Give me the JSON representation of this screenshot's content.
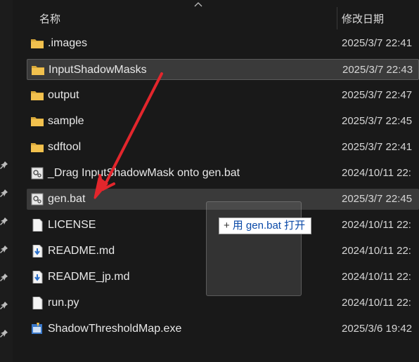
{
  "header": {
    "name_col": "名称",
    "date_col": "修改日期"
  },
  "files": [
    {
      "name": ".images",
      "date": "2025/3/7 22:41",
      "icon": "folder-icon"
    },
    {
      "name": "InputShadowMasks",
      "date": "2025/3/7 22:43",
      "icon": "folder-icon"
    },
    {
      "name": "output",
      "date": "2025/3/7 22:47",
      "icon": "folder-icon"
    },
    {
      "name": "sample",
      "date": "2025/3/7 22:45",
      "icon": "folder-icon"
    },
    {
      "name": "sdftool",
      "date": "2025/3/7 22:41",
      "icon": "folder-icon"
    },
    {
      "name": "_Drag InputShadowMask onto gen.bat",
      "date": "2024/10/11 22:",
      "icon": "batch-file-icon"
    },
    {
      "name": "gen.bat",
      "date": "2025/3/7 22:45",
      "icon": "batch-file-icon"
    },
    {
      "name": "LICENSE",
      "date": "2024/10/11 22:",
      "icon": "document-icon"
    },
    {
      "name": "README.md",
      "date": "2024/10/11 22:",
      "icon": "markdown-file-icon"
    },
    {
      "name": "README_jp.md",
      "date": "2024/10/11 22:",
      "icon": "markdown-file-icon"
    },
    {
      "name": "run.py",
      "date": "2024/10/11 22:",
      "icon": "document-icon"
    },
    {
      "name": "ShadowThresholdMap.exe",
      "date": "2025/3/6 19:42",
      "icon": "exe-file-icon"
    }
  ],
  "drop_tooltip": {
    "plus": "+",
    "text": "用 gen.bat 打开"
  },
  "colors": {
    "background": "#191919",
    "folder": "#f2c14e",
    "annotation_arrow": "#e3262c",
    "tooltip_text": "#0b4aa8"
  }
}
